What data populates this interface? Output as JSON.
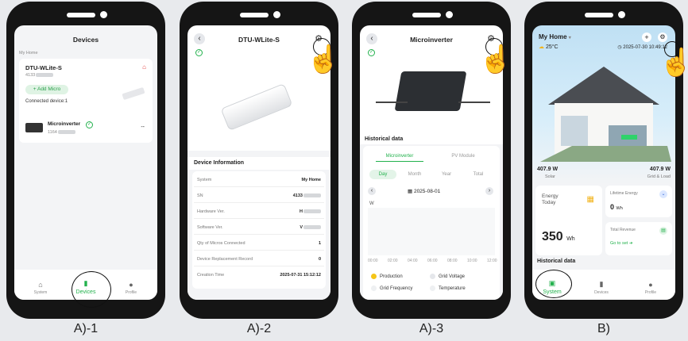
{
  "captions": [
    "A)-1",
    "A)-2",
    "A)-3",
    "B)"
  ],
  "s1": {
    "title": "Devices",
    "section": "My Home",
    "device_name": "DTU-WLite-S",
    "device_sn": "4133",
    "add_button": "+ Add Micro",
    "connected": "Connected device:1",
    "micro_name": "Microinverter",
    "micro_sn": "1164",
    "micro_value": "--",
    "tabs": [
      "System",
      "Devices",
      "Profile"
    ]
  },
  "s2": {
    "title": "DTU-WLite-S",
    "info_title": "Device Information",
    "rows": [
      {
        "label": "System",
        "value": "My Home"
      },
      {
        "label": "SN",
        "value": "4133"
      },
      {
        "label": "Hardware Ver.",
        "value": "H"
      },
      {
        "label": "Software Ver.",
        "value": "V"
      },
      {
        "label": "Qty of Micros Connected",
        "value": "1"
      },
      {
        "label": "Device Replacement Record",
        "value": "0"
      },
      {
        "label": "Creation Time",
        "value": "2025-07-31 15:12:12"
      }
    ]
  },
  "s3": {
    "title": "Microinverter",
    "historical": "Historical data",
    "tabs": [
      "Microinverter",
      "PV Module"
    ],
    "periods": [
      "Day",
      "Month",
      "Year",
      "Total"
    ],
    "date": "2025-08-01",
    "unit": "W",
    "x_ticks": [
      "00:00",
      "02:00",
      "04:00",
      "06:00",
      "08:00",
      "10:00",
      "12:00"
    ],
    "legend": [
      "Production",
      "Grid Voltage",
      "Grid Frequency",
      "Temperature"
    ],
    "colors": {
      "production": "#f5c518",
      "accent": "#22b14c"
    }
  },
  "sB": {
    "home": "My Home",
    "temp": "25°C",
    "datetime": "2025-07-30 10:49:12",
    "solar_value": "407.9 W",
    "solar_label": "Solar",
    "grid_value": "407.9 W",
    "grid_label": "Grid & Load",
    "energy_today_label": "Energy Today",
    "energy_today_value": "350",
    "energy_today_unit": "Wh",
    "lifetime_label": "Lifetime Energy",
    "lifetime_value": "0",
    "lifetime_unit": "Wh",
    "revenue_label": "Total Revenue",
    "revenue_link": "Go to set",
    "historical": "Historical data",
    "tabs": [
      "System",
      "Devices",
      "Profile"
    ]
  }
}
